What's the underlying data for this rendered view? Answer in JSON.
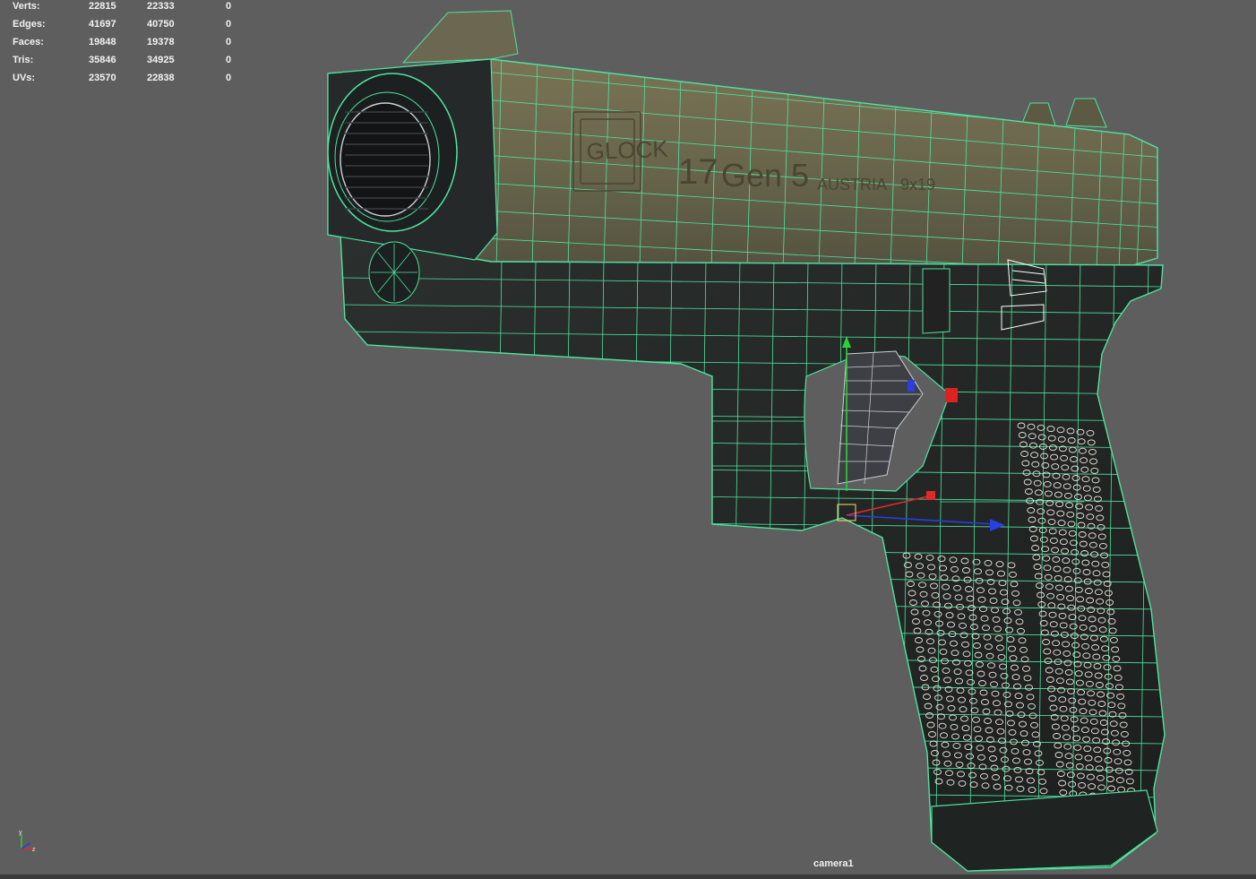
{
  "hud": {
    "rows": [
      {
        "label": "Verts:",
        "v1": "22815",
        "v2": "22333",
        "v3": "0"
      },
      {
        "label": "Edges:",
        "v1": "41697",
        "v2": "40750",
        "v3": "0"
      },
      {
        "label": "Faces:",
        "v1": "19848",
        "v2": "19378",
        "v3": "0"
      },
      {
        "label": "Tris:",
        "v1": "35846",
        "v2": "34925",
        "v3": "0"
      },
      {
        "label": "UVs:",
        "v1": "23570",
        "v2": "22838",
        "v3": "0"
      }
    ]
  },
  "viewport": {
    "camera_label": "camera1",
    "background_color": "#5e5e5e",
    "wireframe_color": "#4fe3a0",
    "axis_labels": {
      "y": "y",
      "z": "z"
    }
  },
  "model": {
    "engraving": {
      "brand": "GLOCK",
      "model": "17",
      "gen": "Gen 5",
      "country": "AUSTRIA",
      "caliber": "9x19"
    }
  },
  "gizmo": {
    "colors": {
      "x": "#e02a2a",
      "y": "#2ad23a",
      "z": "#2a3fe0"
    }
  }
}
